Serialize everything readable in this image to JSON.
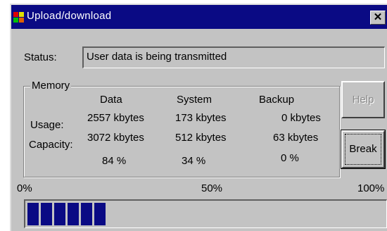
{
  "window": {
    "title": "Upload/download",
    "close_label": "✕"
  },
  "status": {
    "label": "Status:",
    "value": "User data is being transmitted"
  },
  "memory": {
    "legend": "Memory",
    "columns": [
      "Data",
      "System",
      "Backup"
    ],
    "rows": [
      {
        "label": "Usage:",
        "values": [
          "2557 kbytes",
          "173 kbytes",
          "0 kbytes"
        ]
      },
      {
        "label": "Capacity:",
        "values": [
          "3072 kbytes",
          "512 kbytes",
          "63 kbytes"
        ]
      }
    ],
    "percentages": [
      "84 %",
      "34 %",
      "0 %"
    ]
  },
  "buttons": {
    "help_label": "Help",
    "break_label": "Break"
  },
  "progress": {
    "scale_labels": [
      "0%",
      "50%",
      "100%"
    ],
    "fraction": 0.23,
    "bar_color": "#0a0a84"
  },
  "colors": {
    "window_bg": "#c3c3c3",
    "titlebar_bg": "#0a0a84"
  },
  "icons": [
    "app-icon",
    "close-icon"
  ]
}
